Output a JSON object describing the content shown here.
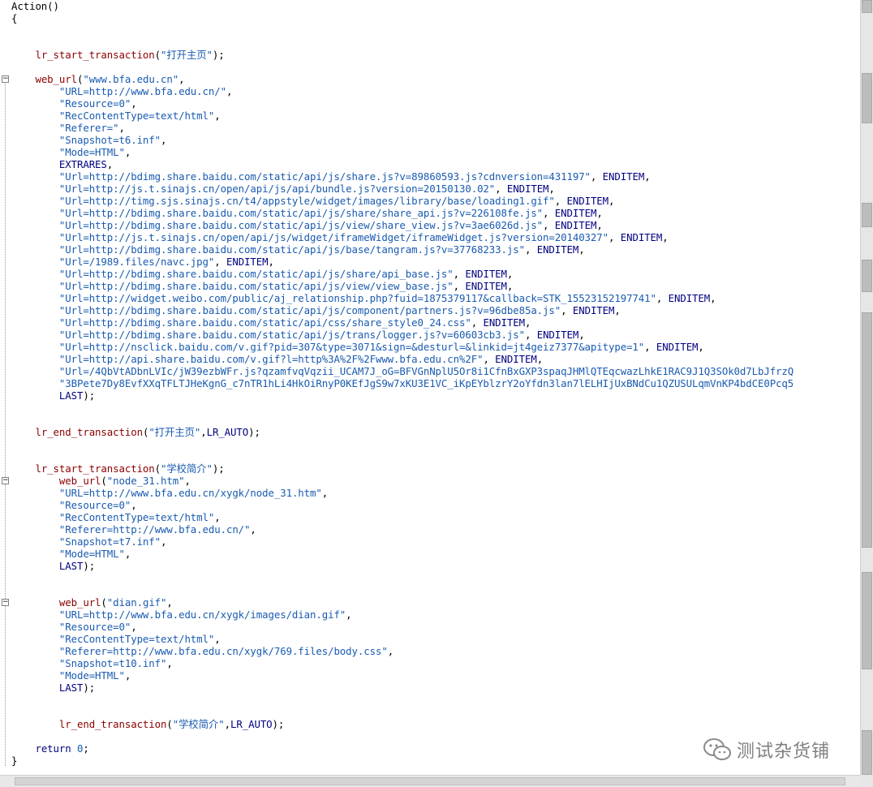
{
  "editor": {
    "lines": [
      {
        "row": 0,
        "parts": [
          [
            "pl",
            "Action()"
          ]
        ]
      },
      {
        "row": 1,
        "parts": [
          [
            "pl",
            "{"
          ]
        ]
      },
      {
        "row": 4,
        "parts": [
          [
            "pl",
            "    "
          ],
          [
            "fn",
            "lr_start_transaction"
          ],
          [
            "pl",
            "("
          ],
          [
            "str",
            "\"打开主页\""
          ],
          [
            "pl",
            ");"
          ]
        ]
      },
      {
        "row": 6,
        "parts": [
          [
            "pl",
            "    "
          ],
          [
            "fn",
            "web_url"
          ],
          [
            "pl",
            "("
          ],
          [
            "str",
            "\"www.bfa.edu.cn\""
          ],
          [
            "pl",
            ","
          ]
        ]
      },
      {
        "row": 7,
        "parts": [
          [
            "pl",
            "        "
          ],
          [
            "str",
            "\"URL=http://www.bfa.edu.cn/\""
          ],
          [
            "pl",
            ","
          ]
        ]
      },
      {
        "row": 8,
        "parts": [
          [
            "pl",
            "        "
          ],
          [
            "str",
            "\"Resource=0\""
          ],
          [
            "pl",
            ","
          ]
        ]
      },
      {
        "row": 9,
        "parts": [
          [
            "pl",
            "        "
          ],
          [
            "str",
            "\"RecContentType=text/html\""
          ],
          [
            "pl",
            ","
          ]
        ]
      },
      {
        "row": 10,
        "parts": [
          [
            "pl",
            "        "
          ],
          [
            "str",
            "\"Referer=\""
          ],
          [
            "pl",
            ","
          ]
        ]
      },
      {
        "row": 11,
        "parts": [
          [
            "pl",
            "        "
          ],
          [
            "str",
            "\"Snapshot=t6.inf\""
          ],
          [
            "pl",
            ","
          ]
        ]
      },
      {
        "row": 12,
        "parts": [
          [
            "pl",
            "        "
          ],
          [
            "str",
            "\"Mode=HTML\""
          ],
          [
            "pl",
            ","
          ]
        ]
      },
      {
        "row": 13,
        "parts": [
          [
            "pl",
            "        "
          ],
          [
            "kw",
            "EXTRARES"
          ],
          [
            "pl",
            ","
          ]
        ]
      },
      {
        "row": 14,
        "parts": [
          [
            "pl",
            "        "
          ],
          [
            "str",
            "\"Url=http://bdimg.share.baidu.com/static/api/js/share.js?v=89860593.js?cdnversion=431197\""
          ],
          [
            "pl",
            ", "
          ],
          [
            "kw",
            "ENDITEM"
          ],
          [
            "pl",
            ","
          ]
        ]
      },
      {
        "row": 15,
        "parts": [
          [
            "pl",
            "        "
          ],
          [
            "str",
            "\"Url=http://js.t.sinajs.cn/open/api/js/api/bundle.js?version=20150130.02\""
          ],
          [
            "pl",
            ", "
          ],
          [
            "kw",
            "ENDITEM"
          ],
          [
            "pl",
            ","
          ]
        ]
      },
      {
        "row": 16,
        "parts": [
          [
            "pl",
            "        "
          ],
          [
            "str",
            "\"Url=http://timg.sjs.sinajs.cn/t4/appstyle/widget/images/library/base/loading1.gif\""
          ],
          [
            "pl",
            ", "
          ],
          [
            "kw",
            "ENDITEM"
          ],
          [
            "pl",
            ","
          ]
        ]
      },
      {
        "row": 17,
        "parts": [
          [
            "pl",
            "        "
          ],
          [
            "str",
            "\"Url=http://bdimg.share.baidu.com/static/api/js/share/share_api.js?v=226108fe.js\""
          ],
          [
            "pl",
            ", "
          ],
          [
            "kw",
            "ENDITEM"
          ],
          [
            "pl",
            ","
          ]
        ]
      },
      {
        "row": 18,
        "parts": [
          [
            "pl",
            "        "
          ],
          [
            "str",
            "\"Url=http://bdimg.share.baidu.com/static/api/js/view/share_view.js?v=3ae6026d.js\""
          ],
          [
            "pl",
            ", "
          ],
          [
            "kw",
            "ENDITEM"
          ],
          [
            "pl",
            ","
          ]
        ]
      },
      {
        "row": 19,
        "parts": [
          [
            "pl",
            "        "
          ],
          [
            "str",
            "\"Url=http://js.t.sinajs.cn/open/api/js/widget/iframeWidget/iframeWidget.js?version=20140327\""
          ],
          [
            "pl",
            ", "
          ],
          [
            "kw",
            "ENDITEM"
          ],
          [
            "pl",
            ","
          ]
        ]
      },
      {
        "row": 20,
        "parts": [
          [
            "pl",
            "        "
          ],
          [
            "str",
            "\"Url=http://bdimg.share.baidu.com/static/api/js/base/tangram.js?v=37768233.js\""
          ],
          [
            "pl",
            ", "
          ],
          [
            "kw",
            "ENDITEM"
          ],
          [
            "pl",
            ","
          ]
        ]
      },
      {
        "row": 21,
        "parts": [
          [
            "pl",
            "        "
          ],
          [
            "str",
            "\"Url=/1989.files/navc.jpg\""
          ],
          [
            "pl",
            ", "
          ],
          [
            "kw",
            "ENDITEM"
          ],
          [
            "pl",
            ","
          ]
        ]
      },
      {
        "row": 22,
        "parts": [
          [
            "pl",
            "        "
          ],
          [
            "str",
            "\"Url=http://bdimg.share.baidu.com/static/api/js/share/api_base.js\""
          ],
          [
            "pl",
            ", "
          ],
          [
            "kw",
            "ENDITEM"
          ],
          [
            "pl",
            ","
          ]
        ]
      },
      {
        "row": 23,
        "parts": [
          [
            "pl",
            "        "
          ],
          [
            "str",
            "\"Url=http://bdimg.share.baidu.com/static/api/js/view/view_base.js\""
          ],
          [
            "pl",
            ", "
          ],
          [
            "kw",
            "ENDITEM"
          ],
          [
            "pl",
            ","
          ]
        ]
      },
      {
        "row": 24,
        "parts": [
          [
            "pl",
            "        "
          ],
          [
            "str",
            "\"Url=http://widget.weibo.com/public/aj_relationship.php?fuid=1875379117&callback=STK_15523152197741\""
          ],
          [
            "pl",
            ", "
          ],
          [
            "kw",
            "ENDITEM"
          ],
          [
            "pl",
            ","
          ]
        ]
      },
      {
        "row": 25,
        "parts": [
          [
            "pl",
            "        "
          ],
          [
            "str",
            "\"Url=http://bdimg.share.baidu.com/static/api/js/component/partners.js?v=96dbe85a.js\""
          ],
          [
            "pl",
            ", "
          ],
          [
            "kw",
            "ENDITEM"
          ],
          [
            "pl",
            ","
          ]
        ]
      },
      {
        "row": 26,
        "parts": [
          [
            "pl",
            "        "
          ],
          [
            "str",
            "\"Url=http://bdimg.share.baidu.com/static/api/css/share_style0_24.css\""
          ],
          [
            "pl",
            ", "
          ],
          [
            "kw",
            "ENDITEM"
          ],
          [
            "pl",
            ","
          ]
        ]
      },
      {
        "row": 27,
        "parts": [
          [
            "pl",
            "        "
          ],
          [
            "str",
            "\"Url=http://bdimg.share.baidu.com/static/api/js/trans/logger.js?v=60603cb3.js\""
          ],
          [
            "pl",
            ", "
          ],
          [
            "kw",
            "ENDITEM"
          ],
          [
            "pl",
            ","
          ]
        ]
      },
      {
        "row": 28,
        "parts": [
          [
            "pl",
            "        "
          ],
          [
            "str",
            "\"Url=http://nsclick.baidu.com/v.gif?pid=307&type=3071&sign=&desturl=&linkid=jt4geiz7377&apitype=1\""
          ],
          [
            "pl",
            ", "
          ],
          [
            "kw",
            "ENDITEM"
          ],
          [
            "pl",
            ","
          ]
        ]
      },
      {
        "row": 29,
        "parts": [
          [
            "pl",
            "        "
          ],
          [
            "str",
            "\"Url=http://api.share.baidu.com/v.gif?l=http%3A%2F%2Fwww.bfa.edu.cn%2F\""
          ],
          [
            "pl",
            ", "
          ],
          [
            "kw",
            "ENDITEM"
          ],
          [
            "pl",
            ","
          ]
        ]
      },
      {
        "row": 30,
        "parts": [
          [
            "pl",
            "        "
          ],
          [
            "str",
            "\"Url=/4QbVtADbnLVIc/jW39ezbWFr.js?qzamfvqVqzii_UCAM7J_oG=BFVGnNplU5Or8i1CfnBxGXP3spaqJHMlQTEqcwazLhkE1RAC9J1Q3SOk0d7LbJfrzQ"
          ]
        ]
      },
      {
        "row": 31,
        "parts": [
          [
            "pl",
            "        "
          ],
          [
            "str",
            "\"3BPete7Dy8EvfXXqTFLTJHeKgnG_c7nTR1hLi4HkOiRnyP0KEfJgS9w7xKU3E1VC_iKpEYblzrY2oYfdn3lan7lELHIjUxBNdCu1QZUSULqmVnKP4bdCE0Pcq5"
          ]
        ]
      },
      {
        "row": 32,
        "parts": [
          [
            "pl",
            "        "
          ],
          [
            "kw",
            "LAST"
          ],
          [
            "pl",
            ");"
          ]
        ]
      },
      {
        "row": 35,
        "parts": [
          [
            "pl",
            "    "
          ],
          [
            "fn",
            "lr_end_transaction"
          ],
          [
            "pl",
            "("
          ],
          [
            "str",
            "\"打开主页\""
          ],
          [
            "pl",
            ","
          ],
          [
            "kw",
            "LR_AUTO"
          ],
          [
            "pl",
            ");"
          ]
        ]
      },
      {
        "row": 38,
        "parts": [
          [
            "pl",
            "    "
          ],
          [
            "fn",
            "lr_start_transaction"
          ],
          [
            "pl",
            "("
          ],
          [
            "str",
            "\"学校简介\""
          ],
          [
            "pl",
            ");"
          ]
        ]
      },
      {
        "row": 39,
        "parts": [
          [
            "pl",
            "        "
          ],
          [
            "fn",
            "web_url"
          ],
          [
            "pl",
            "("
          ],
          [
            "str",
            "\"node_31.htm\""
          ],
          [
            "pl",
            ","
          ]
        ]
      },
      {
        "row": 40,
        "parts": [
          [
            "pl",
            "        "
          ],
          [
            "str",
            "\"URL=http://www.bfa.edu.cn/xygk/node_31.htm\""
          ],
          [
            "pl",
            ","
          ]
        ]
      },
      {
        "row": 41,
        "parts": [
          [
            "pl",
            "        "
          ],
          [
            "str",
            "\"Resource=0\""
          ],
          [
            "pl",
            ","
          ]
        ]
      },
      {
        "row": 42,
        "parts": [
          [
            "pl",
            "        "
          ],
          [
            "str",
            "\"RecContentType=text/html\""
          ],
          [
            "pl",
            ","
          ]
        ]
      },
      {
        "row": 43,
        "parts": [
          [
            "pl",
            "        "
          ],
          [
            "str",
            "\"Referer=http://www.bfa.edu.cn/\""
          ],
          [
            "pl",
            ","
          ]
        ]
      },
      {
        "row": 44,
        "parts": [
          [
            "pl",
            "        "
          ],
          [
            "str",
            "\"Snapshot=t7.inf\""
          ],
          [
            "pl",
            ","
          ]
        ]
      },
      {
        "row": 45,
        "parts": [
          [
            "pl",
            "        "
          ],
          [
            "str",
            "\"Mode=HTML\""
          ],
          [
            "pl",
            ","
          ]
        ]
      },
      {
        "row": 46,
        "parts": [
          [
            "pl",
            "        "
          ],
          [
            "kw",
            "LAST"
          ],
          [
            "pl",
            ");"
          ]
        ]
      },
      {
        "row": 49,
        "parts": [
          [
            "pl",
            "        "
          ],
          [
            "fn",
            "web_url"
          ],
          [
            "pl",
            "("
          ],
          [
            "str",
            "\"dian.gif\""
          ],
          [
            "pl",
            ","
          ]
        ]
      },
      {
        "row": 50,
        "parts": [
          [
            "pl",
            "        "
          ],
          [
            "str",
            "\"URL=http://www.bfa.edu.cn/xygk/images/dian.gif\""
          ],
          [
            "pl",
            ","
          ]
        ]
      },
      {
        "row": 51,
        "parts": [
          [
            "pl",
            "        "
          ],
          [
            "str",
            "\"Resource=0\""
          ],
          [
            "pl",
            ","
          ]
        ]
      },
      {
        "row": 52,
        "parts": [
          [
            "pl",
            "        "
          ],
          [
            "str",
            "\"RecContentType=text/html\""
          ],
          [
            "pl",
            ","
          ]
        ]
      },
      {
        "row": 53,
        "parts": [
          [
            "pl",
            "        "
          ],
          [
            "str",
            "\"Referer=http://www.bfa.edu.cn/xygk/769.files/body.css\""
          ],
          [
            "pl",
            ","
          ]
        ]
      },
      {
        "row": 54,
        "parts": [
          [
            "pl",
            "        "
          ],
          [
            "str",
            "\"Snapshot=t10.inf\""
          ],
          [
            "pl",
            ","
          ]
        ]
      },
      {
        "row": 55,
        "parts": [
          [
            "pl",
            "        "
          ],
          [
            "str",
            "\"Mode=HTML\""
          ],
          [
            "pl",
            ","
          ]
        ]
      },
      {
        "row": 56,
        "parts": [
          [
            "pl",
            "        "
          ],
          [
            "kw",
            "LAST"
          ],
          [
            "pl",
            ");"
          ]
        ]
      },
      {
        "row": 59,
        "parts": [
          [
            "pl",
            "        "
          ],
          [
            "fn",
            "lr_end_transaction"
          ],
          [
            "pl",
            "("
          ],
          [
            "str",
            "\"学校简介\""
          ],
          [
            "pl",
            ","
          ],
          [
            "kw",
            "LR_AUTO"
          ],
          [
            "pl",
            ");"
          ]
        ]
      },
      {
        "row": 61,
        "parts": [
          [
            "pl",
            "    "
          ],
          [
            "kw",
            "return"
          ],
          [
            "pl",
            " "
          ],
          [
            "str",
            "0"
          ],
          [
            "pl",
            ";"
          ]
        ]
      },
      {
        "row": 62,
        "parts": [
          [
            "pl",
            "}"
          ]
        ]
      }
    ],
    "fold_markers": [
      {
        "row": 6,
        "symbol": "−"
      },
      {
        "row": 39,
        "symbol": "−"
      },
      {
        "row": 49,
        "symbol": "−"
      }
    ],
    "colors": {
      "function": "#8b0000",
      "string": "#1a5bb0",
      "keyword": "#000080"
    }
  },
  "watermark": {
    "text": "测试杂货铺",
    "icon": "wechat-icon"
  }
}
